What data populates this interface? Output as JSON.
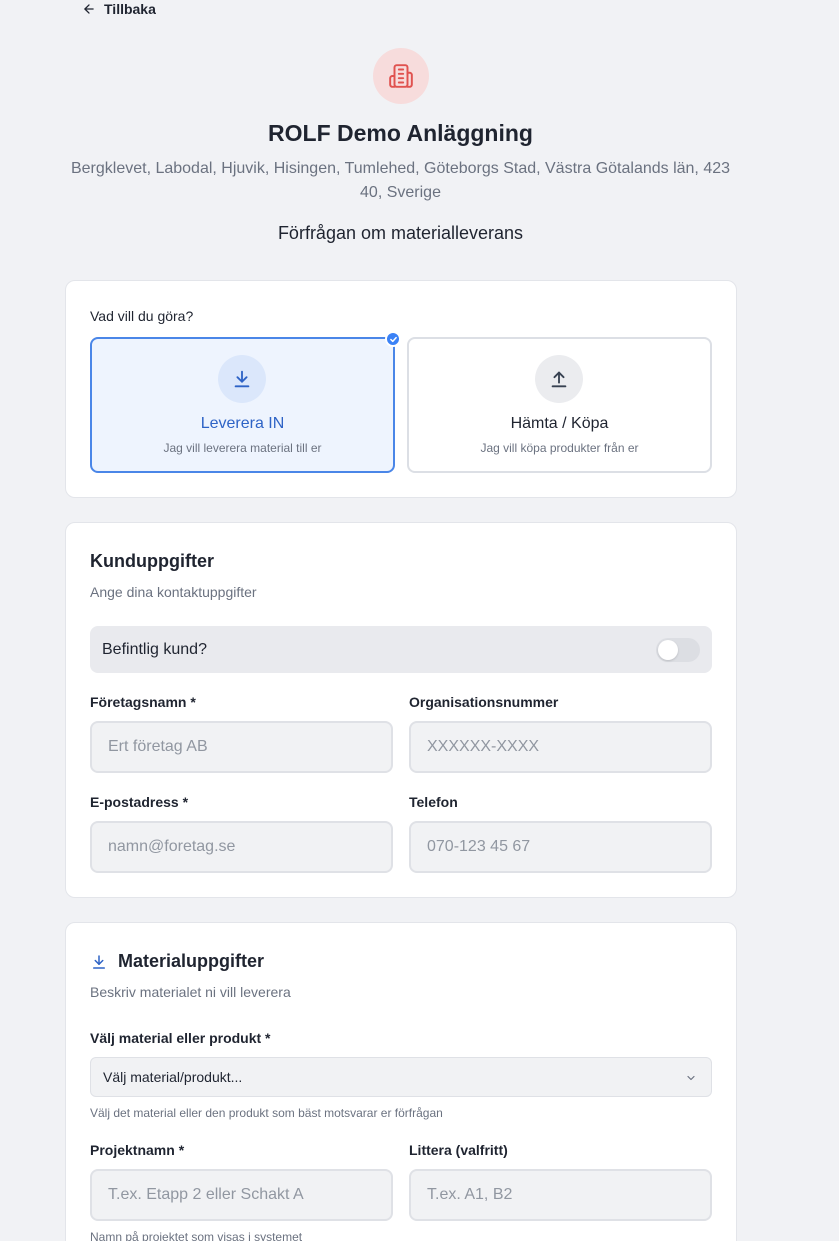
{
  "nav": {
    "back_label": "Tillbaka"
  },
  "header": {
    "title": "ROLF Demo Anläggning",
    "address": "Bergklevet, Labodal, Hjuvik, Hisingen, Tumlehed, Göteborgs Stad, Västra Götalands län, 423 40, Sverige",
    "subtitle": "Förfrågan om materialleverans"
  },
  "action": {
    "question": "Vad vill du göra?",
    "options": [
      {
        "title": "Leverera IN",
        "description": "Jag vill leverera material till er",
        "icon": "download-icon",
        "selected": true
      },
      {
        "title": "Hämta / Köpa",
        "description": "Jag vill köpa produkter från er",
        "icon": "upload-icon",
        "selected": false
      }
    ]
  },
  "customer": {
    "title": "Kunduppgifter",
    "description": "Ange dina kontaktuppgifter",
    "existing_customer_label": "Befintlig kund?",
    "existing_customer": false,
    "fields": {
      "company": {
        "label": "Företagsnamn *",
        "placeholder": "Ert företag AB",
        "value": ""
      },
      "org_number": {
        "label": "Organisationsnummer",
        "placeholder": "XXXXXX-XXXX",
        "value": ""
      },
      "email": {
        "label": "E-postadress *",
        "placeholder": "namn@foretag.se",
        "value": ""
      },
      "phone": {
        "label": "Telefon",
        "placeholder": "070-123 45 67",
        "value": ""
      }
    }
  },
  "material": {
    "title": "Materialuppgifter",
    "description": "Beskriv materialet ni vill leverera",
    "select_label": "Välj material eller produkt *",
    "select_value": "Välj material/produkt...",
    "select_hint": "Välj det material eller den produkt som bäst motsvarar er förfrågan",
    "project": {
      "label": "Projektnamn *",
      "placeholder": "T.ex. Etapp 2 eller Schakt A",
      "hint": "Namn på projektet som visas i systemet"
    },
    "littera": {
      "label": "Littera (valfritt)",
      "placeholder": "T.ex. A1, B2"
    }
  },
  "colors": {
    "accent": "#2e63c6",
    "selected_border": "#4a86e8",
    "brand_icon": "#e0524f",
    "brand_bg": "#f7dcdc"
  }
}
